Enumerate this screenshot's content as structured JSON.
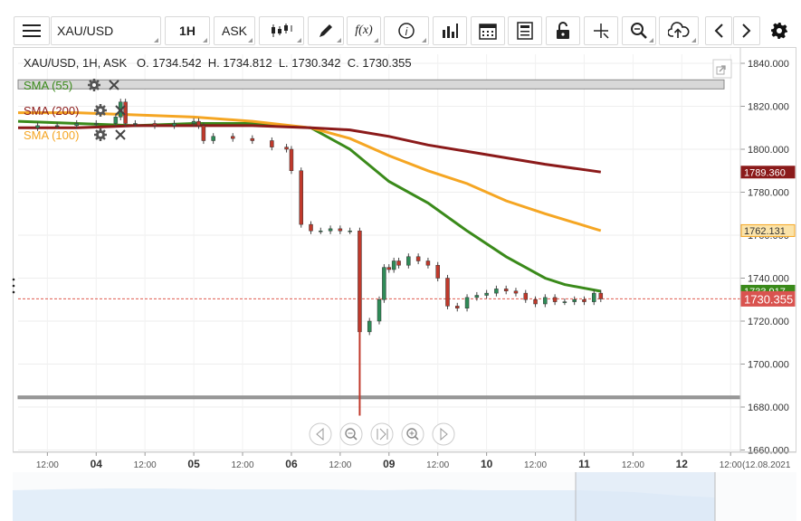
{
  "toolbar": {
    "symbol": "XAU/USD",
    "timeframe": "1H",
    "price_side": "ASK",
    "icons": [
      "menu-icon",
      "candlestick-icon",
      "pencil-icon",
      "function-icon",
      "info-icon",
      "volume-bars-icon",
      "calendar-icon",
      "template-icon",
      "lock-icon",
      "crosshair-icon",
      "zoom-icon",
      "cloud-upload-icon",
      "chevron-left-icon",
      "chevron-right-icon",
      "gear-icon"
    ],
    "function_glyph": "f(x)"
  },
  "header": {
    "info": "XAU/USD, 1H, ASK   O. 1734.542  H. 1734.812  L. 1730.342  C. 1730.355"
  },
  "indicators": [
    {
      "label": "SMA (55)",
      "color": "#3a8a1a"
    },
    {
      "label": "SMA (200)",
      "color": "#8b1a1a"
    },
    {
      "label": "SMA (100)",
      "color": "#f5a623"
    }
  ],
  "price_tags": {
    "sma200": "1789.360",
    "sma100": "1762.131",
    "sma55": "1733.917",
    "last": "1730.355"
  },
  "colors": {
    "up": "#2e8b57",
    "down": "#c0392b",
    "sma55": "#3a8a1a",
    "sma200": "#8b1a1a",
    "sma100": "#f5a623",
    "last_tag": "#d9534f"
  },
  "chart_data": {
    "type": "line",
    "title": "XAU/USD, 1H, ASK",
    "y_ticks": [
      "1840.000",
      "1820.000",
      "1800.000",
      "1780.000",
      "1760.000",
      "1740.000",
      "1720.000",
      "1700.000",
      "1680.000",
      "1660.000"
    ],
    "ylim": [
      1660,
      1845
    ],
    "x_ticks": [
      "12:00",
      "04",
      "12:00",
      "05",
      "12:00",
      "06",
      "12:00",
      "09",
      "12:00",
      "10",
      "12:00",
      "11",
      "12:00",
      "12",
      "12:00"
    ],
    "x_tick_pos": [
      -5,
      0,
      5,
      10,
      15,
      20,
      25,
      30,
      35,
      40,
      45,
      50,
      55,
      60,
      65
    ],
    "last_date_label": "(12.08.2021",
    "xlim": [
      -8,
      66
    ],
    "horizontal_levels": [
      1830.2,
      1684.5
    ],
    "last_price": 1730.355,
    "series": [
      {
        "name": "SMA (55)",
        "x": [
          -8,
          -2,
          4,
          10,
          16,
          22,
          26,
          30,
          34,
          38,
          42,
          46,
          48,
          51.7
        ],
        "values": [
          1813,
          1812,
          1811,
          1812,
          1812,
          1810,
          1800,
          1785,
          1775,
          1762,
          1750,
          1740,
          1737,
          1733.9
        ]
      },
      {
        "name": "SMA (100)",
        "x": [
          -8,
          -2,
          4,
          10,
          16,
          22,
          26,
          30,
          34,
          38,
          42,
          46,
          51.7
        ],
        "values": [
          1817,
          1817,
          1816,
          1815,
          1813,
          1810,
          1805,
          1797,
          1790,
          1784,
          1776,
          1770,
          1762.1
        ]
      },
      {
        "name": "SMA (200)",
        "x": [
          -8,
          -2,
          4,
          10,
          16,
          22,
          26,
          30,
          34,
          38,
          42,
          46,
          51.7
        ],
        "values": [
          1810,
          1810,
          1811,
          1811,
          1811,
          1810,
          1809,
          1806,
          1802,
          1799,
          1796,
          1793,
          1789.4
        ]
      },
      {
        "name": "Close",
        "x": [
          -8,
          -6,
          -4,
          -2,
          0,
          2,
          2.5,
          3,
          4,
          6,
          8,
          10,
          10.5,
          11,
          12,
          14,
          16,
          18,
          19.5,
          20,
          21,
          22,
          23,
          24,
          25,
          26,
          27,
          28,
          29,
          29.5,
          30,
          30.5,
          31,
          32,
          33,
          34,
          35,
          36,
          37,
          38,
          39,
          40,
          41,
          42,
          43,
          44,
          45,
          46,
          47,
          48,
          49,
          50,
          51,
          51.7
        ],
        "values": [
          1810,
          1811,
          1811,
          1812,
          1812,
          1815,
          1822,
          1812,
          1812,
          1811,
          1812,
          1813,
          1811,
          1804,
          1806,
          1805,
          1804,
          1801,
          1800,
          1790,
          1765,
          1762,
          1762,
          1763,
          1762,
          1762,
          1715,
          1720,
          1730,
          1745,
          1744,
          1748,
          1746,
          1750,
          1748,
          1746,
          1740,
          1727,
          1726,
          1731,
          1732,
          1733,
          1735,
          1734,
          1733,
          1730,
          1728,
          1731,
          1729,
          1729,
          1730,
          1729,
          1733,
          1730.355
        ]
      }
    ]
  }
}
